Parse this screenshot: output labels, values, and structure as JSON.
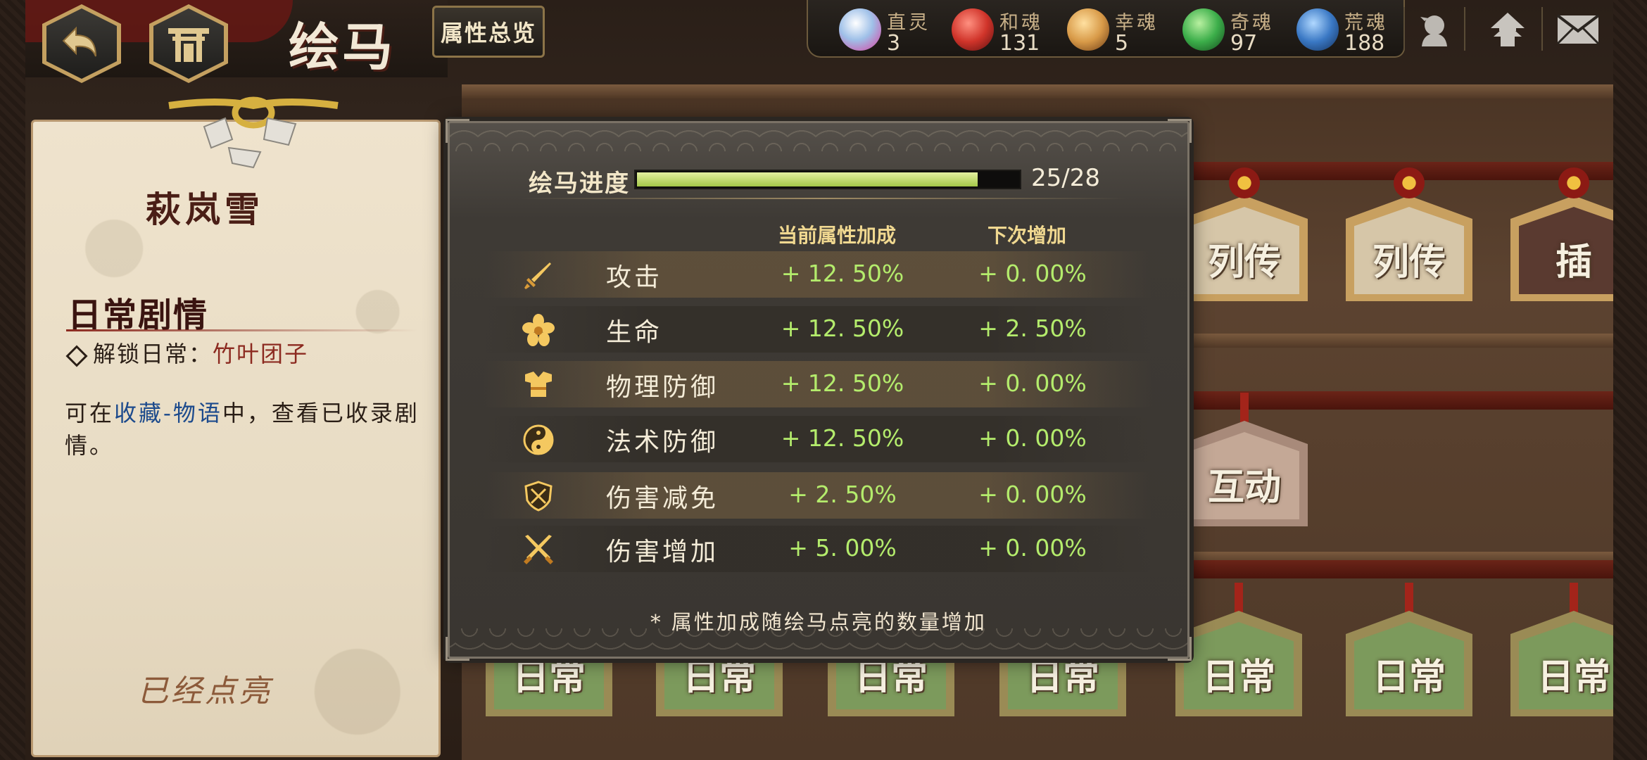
{
  "header": {
    "title": "绘马",
    "attr_overview_label": "属性总览"
  },
  "resources": [
    {
      "name": "直灵",
      "value": "3",
      "color": "#9fc0e8"
    },
    {
      "name": "和魂",
      "value": "131",
      "color": "#d0342a"
    },
    {
      "name": "幸魂",
      "value": "5",
      "color": "#d89a48"
    },
    {
      "name": "奇魂",
      "value": "97",
      "color": "#3cae4a"
    },
    {
      "name": "荒魂",
      "value": "188",
      "color": "#3a78c4"
    }
  ],
  "top_icons": [
    "profile-icon",
    "upgrade-arrow-icon",
    "mail-icon"
  ],
  "left_panel": {
    "character_name": "萩岚雪",
    "section_title": "日常剧情",
    "unlock_prefix": "解锁日常：",
    "unlock_item": "竹叶团子",
    "desc_part1": "可在",
    "desc_link": "收藏-物语",
    "desc_part2": "中，查看已收录剧情。",
    "status": "已经点亮"
  },
  "dialog": {
    "progress_label": "绘马进度",
    "progress_text": "25/28",
    "progress_current": 25,
    "progress_total": 28,
    "col_current": "当前属性加成",
    "col_next": "下次增加",
    "stats": [
      {
        "icon": "sword-icon",
        "name": "攻击",
        "current": "+ 12. 50%",
        "next": "+ 0. 00%"
      },
      {
        "icon": "flower-icon",
        "name": "生命",
        "current": "+ 12. 50%",
        "next": "+ 2. 50%"
      },
      {
        "icon": "armor-icon",
        "name": "物理防御",
        "current": "+ 12. 50%",
        "next": "+ 0. 00%"
      },
      {
        "icon": "yinyang-icon",
        "name": "法术防御",
        "current": "+ 12. 50%",
        "next": "+ 0. 00%"
      },
      {
        "icon": "shield-icon",
        "name": "伤害减免",
        "current": "+ 2. 50%",
        "next": "+ 0. 00%"
      },
      {
        "icon": "crossed-swords-icon",
        "name": "伤害增加",
        "current": "+ 5. 00%",
        "next": "+ 0. 00%"
      }
    ],
    "footnote": "* 属性加成随绘马点亮的数量增加"
  },
  "ema_labels": {
    "biography": "列传",
    "interaction": "互动",
    "daily": "日常",
    "edge": "插"
  },
  "colors": {
    "accent_gold": "#f0d890",
    "value_green": "#b4ec6c",
    "progress_fill": "#a4c848",
    "dark_red": "#4a1e16",
    "link_blue": "#1c4a8c"
  }
}
